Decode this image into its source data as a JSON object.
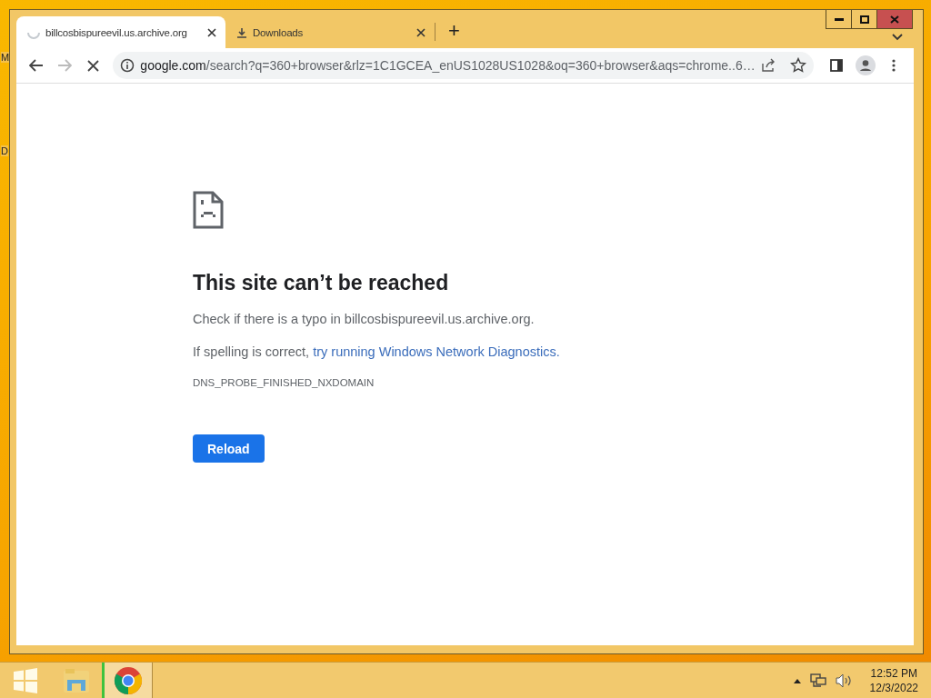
{
  "desktop": {
    "icon_labels": [
      "M",
      "D"
    ]
  },
  "browser": {
    "tabs": [
      {
        "kind": "loading",
        "title": "billcosbispureevil.us.archive.org",
        "selected": true
      },
      {
        "kind": "downloads",
        "title": "Downloads",
        "selected": false
      }
    ],
    "new_tab": "+",
    "toolbar": {
      "forward_disabled": true,
      "loading": true,
      "url_host": "google.com",
      "url_rest": "/search?q=360+browser&rlz=1C1GCEA_enUS1028US1028&oq=360+browser&aqs=chrome..6…"
    },
    "page": {
      "heading": "This site can’t be reached",
      "check_text": "Check if there is a typo in billcosbispureevil.us.archive.org.",
      "suggestion_prefix": "If spelling is correct, ",
      "suggestion_link": "try running Windows Network Diagnostics.",
      "error_code": "DNS_PROBE_FINISHED_NXDOMAIN",
      "button": "Reload"
    }
  },
  "taskbar": {
    "apps": [
      {
        "kind": "explorer",
        "selected": false
      },
      {
        "kind": "chrome",
        "selected": true
      }
    ],
    "time": "12:52 PM",
    "date": "12/3/2022"
  }
}
